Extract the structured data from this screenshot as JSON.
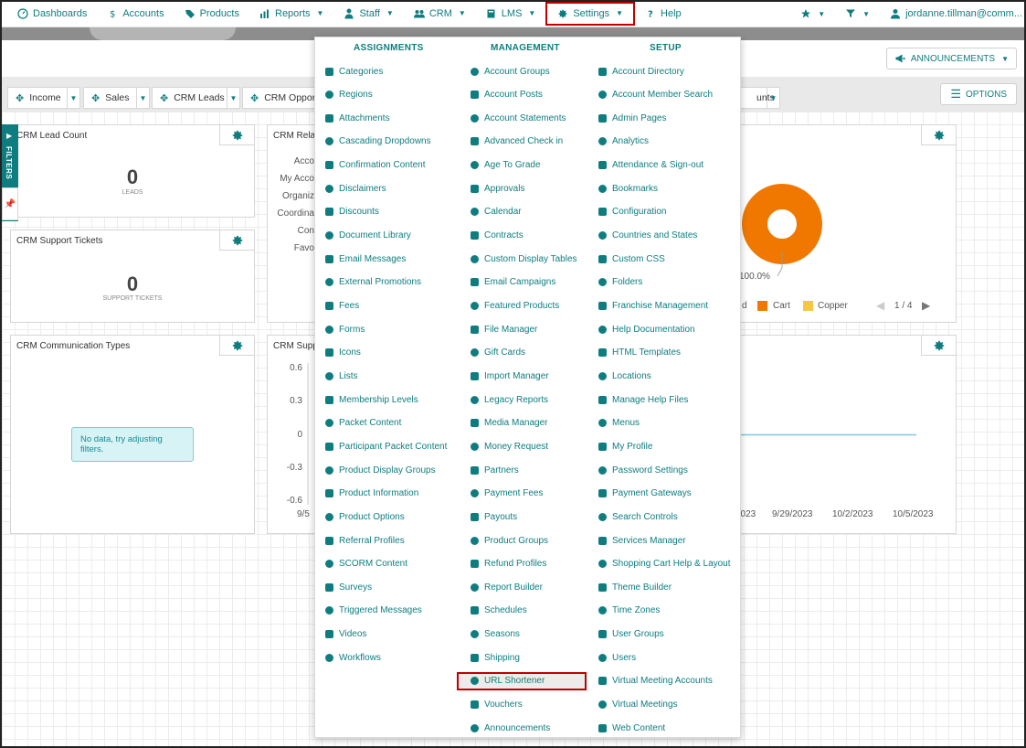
{
  "nav": {
    "items": [
      {
        "label": "Dashboards",
        "icon": "dashboard-icon"
      },
      {
        "label": "Accounts",
        "icon": "dollar-icon"
      },
      {
        "label": "Products",
        "icon": "tag-icon"
      },
      {
        "label": "Reports",
        "icon": "chart-icon",
        "dropdown": true
      },
      {
        "label": "Staff",
        "icon": "person-icon",
        "dropdown": true
      },
      {
        "label": "CRM",
        "icon": "people-icon",
        "dropdown": true
      },
      {
        "label": "LMS",
        "icon": "book-icon",
        "dropdown": true
      },
      {
        "label": "Settings",
        "icon": "gear-icon",
        "dropdown": true,
        "selected": true
      },
      {
        "label": "Help",
        "icon": "question-icon"
      }
    ],
    "user": "jordanne.tillman@comm..."
  },
  "announcements_label": "ANNOUNCEMENTS",
  "options_label": "OPTIONS",
  "tabs": [
    "Income",
    "Sales",
    "CRM Leads",
    "CRM Opport"
  ],
  "tab_tail": "unts",
  "filters_label": "FILTERS",
  "panels": {
    "lead_count": {
      "title": "CRM Lead Count",
      "value": "0",
      "caption": "LEADS"
    },
    "support_tickets": {
      "title": "CRM Support Tickets",
      "value": "0",
      "caption": "SUPPORT TICKETS"
    },
    "comm_types": {
      "title": "CRM Communication Types",
      "nodata": "No data, try adjusting filters."
    },
    "relations": {
      "title": "CRM Relat",
      "rows": [
        "Acco",
        "My Acco",
        "Organiz",
        "Coordina",
        "Con",
        "Favo"
      ]
    },
    "support_chart": {
      "title": "CRM Supp"
    },
    "pie": {
      "percent": "100.0%",
      "legend": [
        "d",
        "Cart",
        "Copper"
      ],
      "page": "1 / 4"
    }
  },
  "chart_data": {
    "type": "line",
    "ylim": [
      -0.6,
      0.6
    ],
    "yticks": [
      "0.6",
      "0.3",
      "0",
      "-0.3",
      "-0.6"
    ],
    "xticks": [
      "9/5",
      "2023",
      "9/29/2023",
      "10/2/2023",
      "10/5/2023"
    ],
    "series": [
      {
        "values": [
          0,
          0,
          0,
          0,
          0
        ]
      }
    ],
    "colors": {
      "line": "#7ec8e3"
    }
  },
  "menu": {
    "columns": [
      {
        "heading": "ASSIGNMENTS",
        "items": [
          "Categories",
          "Regions",
          "Attachments",
          "Cascading Dropdowns",
          "Confirmation Content",
          "Disclaimers",
          "Discounts",
          "Document Library",
          "Email Messages",
          "External Promotions",
          "Fees",
          "Forms",
          "Icons",
          "Lists",
          "Membership Levels",
          "Packet Content",
          "Participant Packet Content",
          "Product Display Groups",
          "Product Information",
          "Product Options",
          "Referral Profiles",
          "SCORM Content",
          "Surveys",
          "Triggered Messages",
          "Videos",
          "Workflows"
        ]
      },
      {
        "heading": "MANAGEMENT",
        "items": [
          "Account Groups",
          "Account Posts",
          "Account Statements",
          "Advanced Check in",
          "Age To Grade",
          "Approvals",
          "Calendar",
          "Contracts",
          "Custom Display Tables",
          "Email Campaigns",
          "Featured Products",
          "File Manager",
          "Gift Cards",
          "Import Manager",
          "Legacy Reports",
          "Media Manager",
          "Money Request",
          "Partners",
          "Payment Fees",
          "Payouts",
          "Product Groups",
          "Refund Profiles",
          "Report Builder",
          "Schedules",
          "Seasons",
          "Shipping",
          "URL Shortener",
          "Vouchers",
          "Announcements"
        ]
      },
      {
        "heading": "SETUP",
        "items": [
          "Account Directory",
          "Account Member Search",
          "Admin Pages",
          "Analytics",
          "Attendance & Sign-out",
          "Bookmarks",
          "Configuration",
          "Countries and States",
          "Custom CSS",
          "Folders",
          "Franchise Management",
          "Help Documentation",
          "HTML Templates",
          "Locations",
          "Manage Help Files",
          "Menus",
          "My Profile",
          "Password Settings",
          "Payment Gateways",
          "Search Controls",
          "Services Manager",
          "Shopping Cart Help & Layout",
          "Theme Builder",
          "Time Zones",
          "User Groups",
          "Users",
          "Virtual Meeting Accounts",
          "Virtual Meetings",
          "Web Content"
        ]
      }
    ],
    "highlighted": "URL Shortener"
  },
  "colors": {
    "accent": "#0f7d7f",
    "highlight_border": "#c00000",
    "pie": "#f07800",
    "copper": "#f5c842"
  }
}
